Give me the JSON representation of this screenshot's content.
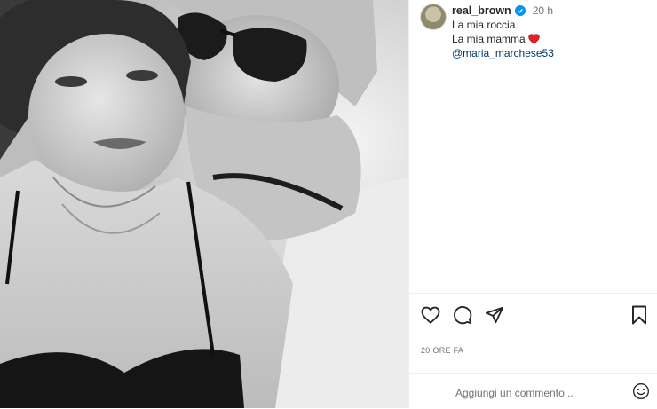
{
  "post": {
    "username": "real_brown",
    "time": "20 h",
    "caption_lines": [
      "La mia roccia.",
      "La mia mamma"
    ],
    "mention": "@maria_marchese53",
    "timestamp": "20 ORE FA"
  },
  "comment": {
    "placeholder": "Aggiungi un commento..."
  },
  "colors": {
    "verified": "#0095f6",
    "heart": "#ed1c24",
    "mention": "#00376b",
    "muted": "#737373"
  },
  "icons": {
    "like": "heart-outline-icon",
    "comment": "speech-bubble-icon",
    "share": "paper-plane-icon",
    "save": "bookmark-icon",
    "emoji": "smiley-icon",
    "verified": "verified-badge-icon",
    "caption_emoji": "red-heart-icon"
  }
}
